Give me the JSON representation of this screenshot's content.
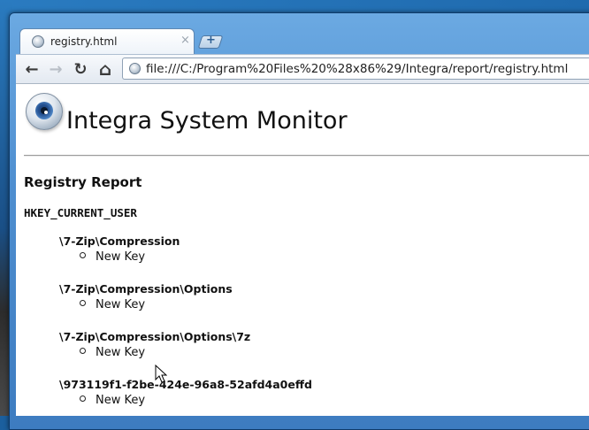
{
  "browser": {
    "tab_title": "registry.html",
    "tab_close": "×",
    "new_tab_symbol": "+",
    "url": "file:///C:/Program%20Files%20%28x86%29/Integra/report/registry.html",
    "nav": {
      "back": "←",
      "forward": "→",
      "reload": "↻",
      "home": "⌂"
    }
  },
  "page": {
    "title": "Integra System Monitor",
    "report_title": "Registry Report",
    "hive": "HKEY_CURRENT_USER",
    "entries": [
      {
        "path": "\\7-Zip\\Compression",
        "value": "New Key"
      },
      {
        "path": "\\7-Zip\\Compression\\Options",
        "value": "New Key"
      },
      {
        "path": "\\7-Zip\\Compression\\Options\\7z",
        "value": "New Key"
      },
      {
        "path": "\\973119f1-f2be-424e-96a8-52afd4a0effd",
        "value": "New Key"
      }
    ]
  },
  "colors": {
    "window_frame": "#4f8fd0",
    "toolbar": "#e3e9f1",
    "page_background": "#ffffff",
    "text": "#111111"
  }
}
